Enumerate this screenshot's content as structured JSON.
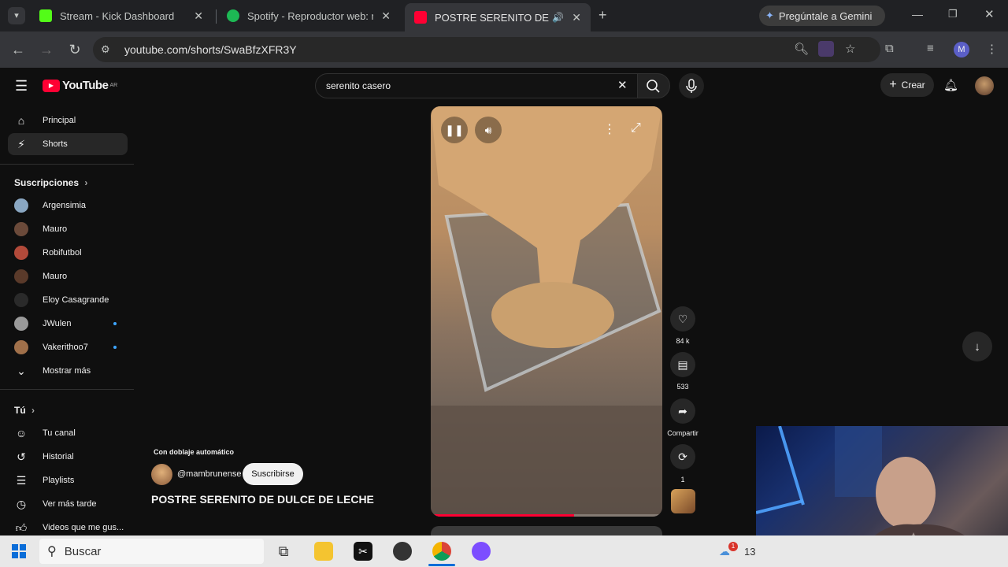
{
  "browser": {
    "tabs": [
      {
        "title": "Stream - Kick Dashboard",
        "favicon_color": "#53fc18"
      },
      {
        "title": "Spotify - Reproductor web: músi",
        "favicon_color": "#1db954"
      },
      {
        "title": "POSTRE SERENITO DE DULC",
        "favicon_color": "#ff0033"
      }
    ],
    "new_tab_label": "+",
    "gemini_label": "Pregúntale a Gemini",
    "url": "youtube.com/shorts/SwaBfzXFR3Y",
    "profile_initial": "M"
  },
  "youtube": {
    "logo_text": "YouTube",
    "country_code": "AR",
    "search_value": "serenito casero",
    "create_label": "Crear",
    "sidebar": {
      "main": [
        {
          "label": "Principal",
          "icon": "home-icon"
        },
        {
          "label": "Shorts",
          "icon": "shorts-icon"
        }
      ],
      "subscriptions_title": "Suscripciones",
      "subscriptions": [
        {
          "label": "Argensimia",
          "color": "#8aa7c2",
          "new": false
        },
        {
          "label": "Mauro",
          "color": "#6b4a3a",
          "new": false
        },
        {
          "label": "Robifutbol",
          "color": "#b24a3a",
          "new": false
        },
        {
          "label": "Mauro",
          "color": "#5a3a2a",
          "new": false
        },
        {
          "label": "Eloy Casagrande",
          "color": "#2a2a2a",
          "new": false
        },
        {
          "label": "JWulen",
          "color": "#9a9a9a",
          "new": true
        },
        {
          "label": "Vakerithoo7",
          "color": "#a0704a",
          "new": true
        }
      ],
      "show_more": "Mostrar más",
      "you_title": "Tú",
      "you_items": [
        {
          "label": "Tu canal",
          "icon": "channel-icon"
        },
        {
          "label": "Historial",
          "icon": "history-icon"
        },
        {
          "label": "Playlists",
          "icon": "playlist-icon"
        },
        {
          "label": "Ver más tarde",
          "icon": "watch-later-icon"
        },
        {
          "label": "Videos que me gus...",
          "icon": "like-icon"
        }
      ]
    },
    "short": {
      "dub_label": "Con doblaje automático",
      "channel": "@mambrunense",
      "subscribe_label": "Suscribirse",
      "title": "POSTRE SERENITO DE DULCE DE LECHE",
      "likes": "84 k",
      "comments": "533",
      "share_label": "Compartir",
      "remix_count": "1",
      "progress": 0.62
    }
  },
  "taskbar": {
    "search_placeholder": "Buscar",
    "notification_count": "1",
    "clock_fragment": "13"
  }
}
